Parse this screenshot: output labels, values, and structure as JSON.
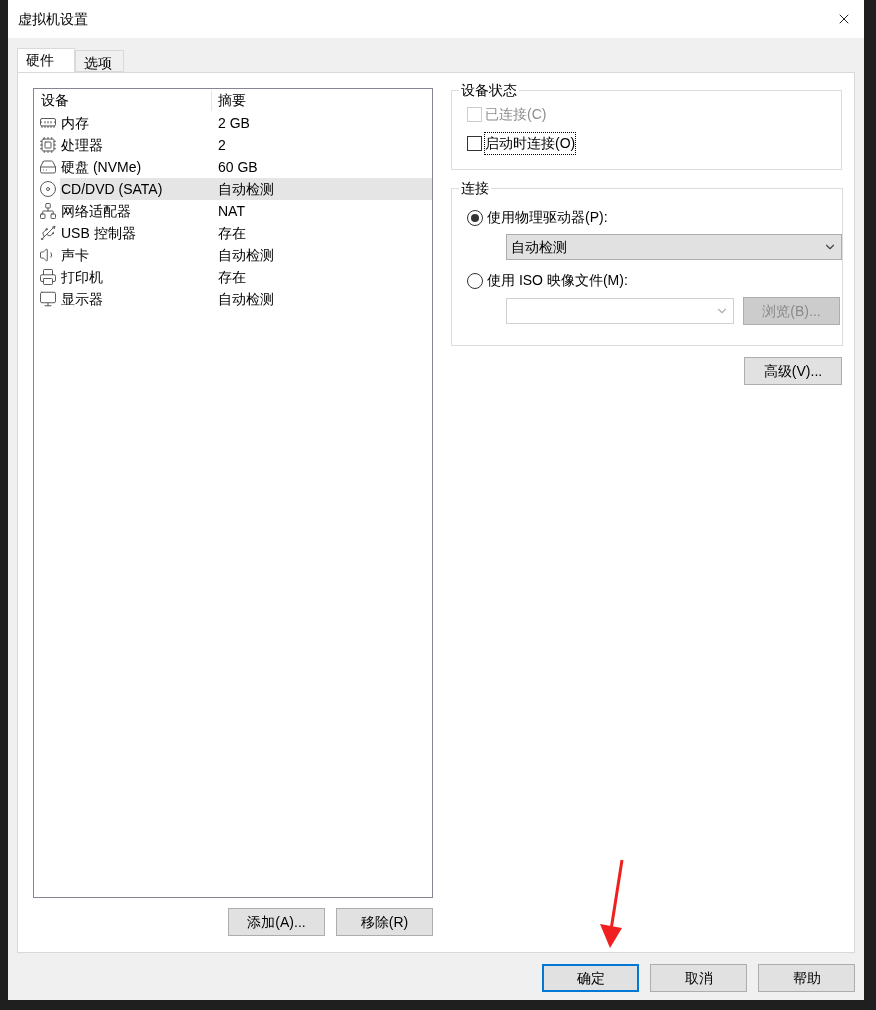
{
  "window": {
    "title": "虚拟机设置"
  },
  "tabs": [
    {
      "label": "硬件",
      "selected": true
    },
    {
      "label": "选项",
      "selected": false
    }
  ],
  "device_list": {
    "columns": [
      "设备",
      "摘要"
    ],
    "rows": [
      {
        "kind": "memory",
        "name": "内存",
        "summary": "2 GB",
        "selected": false
      },
      {
        "kind": "cpu",
        "name": "处理器",
        "summary": "2",
        "selected": false
      },
      {
        "kind": "disk",
        "name": "硬盘 (NVMe)",
        "summary": "60 GB",
        "selected": false
      },
      {
        "kind": "cdrom",
        "name": "CD/DVD (SATA)",
        "summary": "自动检测",
        "selected": true
      },
      {
        "kind": "network",
        "name": "网络适配器",
        "summary": "NAT",
        "selected": false
      },
      {
        "kind": "usb",
        "name": "USB 控制器",
        "summary": "存在",
        "selected": false
      },
      {
        "kind": "sound",
        "name": "声卡",
        "summary": "自动检测",
        "selected": false
      },
      {
        "kind": "printer",
        "name": "打印机",
        "summary": "存在",
        "selected": false
      },
      {
        "kind": "display",
        "name": "显示器",
        "summary": "自动检测",
        "selected": false
      }
    ]
  },
  "list_buttons": [
    "添加(A)...",
    "移除(R)"
  ],
  "device_status": {
    "title": "设备状态",
    "checkboxes": [
      {
        "label": "已连接(C)",
        "checked": false,
        "disabled": true,
        "focused": false
      },
      {
        "label": "启动时连接(O)",
        "checked": false,
        "disabled": false,
        "focused": true
      }
    ]
  },
  "connection": {
    "title": "连接",
    "options": [
      {
        "label": "使用物理驱动器(P):",
        "selected": true,
        "dropdown": {
          "value": "自动检测",
          "disabled": false
        }
      },
      {
        "label": "使用 ISO 映像文件(M):",
        "selected": false,
        "dropdown": {
          "disabled": true
        },
        "browse": {
          "label": "浏览(B)...",
          "disabled": true
        }
      }
    ]
  },
  "advanced_button": "高级(V)...",
  "dialog_buttons": [
    {
      "label": "确定",
      "default": true
    },
    {
      "label": "取消",
      "default": false
    },
    {
      "label": "帮助",
      "default": false
    }
  ],
  "annotation": {
    "kind": "arrow"
  }
}
